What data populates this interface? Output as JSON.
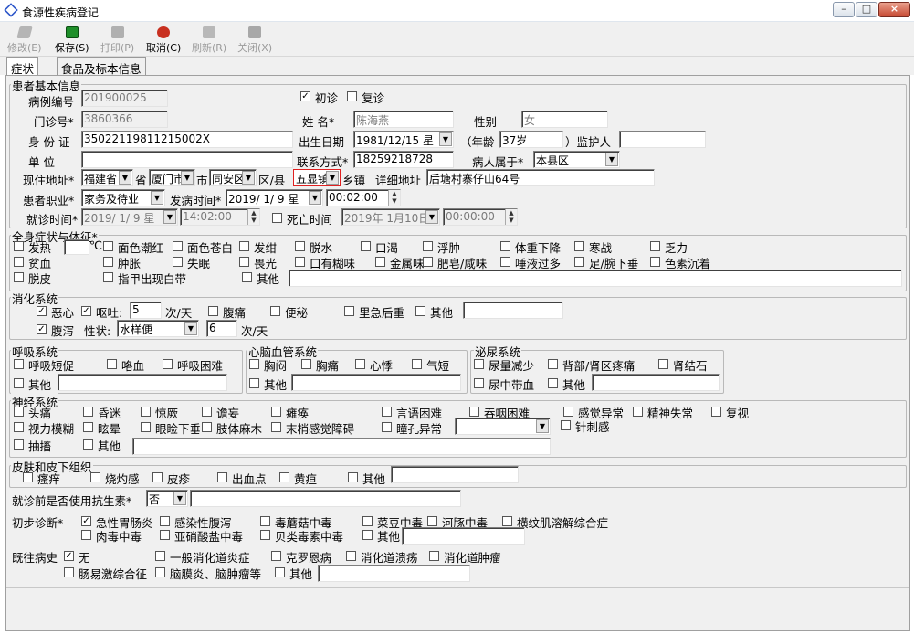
{
  "window": {
    "title": "食源性疾病登记"
  },
  "toolbar": {
    "items": [
      {
        "label": "修改(E)",
        "disabled": true
      },
      {
        "label": "保存(S)",
        "disabled": false
      },
      {
        "label": "打印(P)",
        "disabled": true
      },
      {
        "label": "取消(C)",
        "disabled": false
      },
      {
        "label": "刷新(R)",
        "disabled": true
      },
      {
        "label": "关闭(X)",
        "disabled": true
      }
    ]
  },
  "tabs": [
    "症状",
    "食品及标本信息"
  ],
  "patient": {
    "legend": "患者基本信息",
    "case_no_label": "病例编号",
    "case_no": "201900025",
    "first_visit": "初诊",
    "revisit": "复诊",
    "outpatient_label": "门诊号*",
    "outpatient_no": "3860366",
    "name_label": "姓 名*",
    "name": "陈海燕",
    "gender_label": "性别",
    "gender": "女",
    "id_label": "身 份 证",
    "id_no": "35022119811215002X",
    "birth_label": "出生日期",
    "birth": "1981/12/15 星",
    "age_open": "（年龄",
    "age": "37岁",
    "age_close": "）监护人",
    "guardian": "",
    "unit_label": "单 位",
    "unit": "",
    "contact_label": "联系方式*",
    "contact": "18259218728",
    "belong_label": "病人属于*",
    "belong": "本县区",
    "addr_label": "现住地址*",
    "province": "福建省",
    "province_suffix": "省",
    "city": "厦门市",
    "city_suffix": "市",
    "district": "同安区",
    "district_suffix": "区/县",
    "town": "五显镇",
    "town_suffix": "乡镇",
    "detail_label": "详细地址",
    "detail": "后塘村寨仔山64号",
    "job_label": "患者职业*",
    "job": "家务及待业",
    "onset_label": "发病时间*",
    "onset_date": "2019/ 1/ 9 星",
    "onset_time": "00:02:00",
    "visit_label": "就诊时间*",
    "visit_date": "2019/ 1/ 9 星",
    "visit_time": "14:02:00",
    "death_label": "死亡时间",
    "death_date": "2019年 1月10日",
    "death_time": "00:00:00"
  },
  "general": {
    "legend": "全身症状与体征*",
    "items": [
      "发热",
      "面色潮红",
      "面色苍白",
      "发绀",
      "脱水",
      "口渴",
      "浮肿",
      "体重下降",
      "寒战",
      "乏力",
      "贫血",
      "肿胀",
      "失眠",
      "畏光",
      "口有糊味",
      "金属味",
      "肥皂/咸味",
      "唾液过多",
      "足/腕下垂",
      "色素沉着",
      "脱皮",
      "指甲出现白带",
      "其他"
    ],
    "fever_unit": "℃"
  },
  "digestive": {
    "legend": "消化系统",
    "nausea": "恶心",
    "vomit": "呕吐:",
    "vomit_count": "5",
    "per_day": "次/天",
    "bellyache": "腹痛",
    "constipation": "便秘",
    "tenesmus": "里急后重",
    "other": "其他",
    "diarrhea": "腹泻",
    "nature_label": "性状:",
    "nature": "水样便",
    "diarrhea_count": "6",
    "per_day2": "次/天"
  },
  "respiratory": {
    "legend": "呼吸系统",
    "items": [
      "呼吸短促",
      "咯血",
      "呼吸困难",
      "其他"
    ]
  },
  "cardio": {
    "legend": "心脑血管系统",
    "items": [
      "胸闷",
      "胸痛",
      "心悸",
      "气短",
      "其他"
    ]
  },
  "urinary": {
    "legend": "泌尿系统",
    "items": [
      "尿量减少",
      "背部/肾区疼痛",
      "肾结石",
      "尿中带血",
      "其他"
    ]
  },
  "nervous": {
    "legend": "神经系统",
    "items": [
      "头痛",
      "昏迷",
      "惊厥",
      "谵妄",
      "瘫痪",
      "言语困难",
      "吞咽困难",
      "感觉异常",
      "精神失常",
      "复视",
      "视力模糊",
      "眩晕",
      "眼睑下垂",
      "肢体麻木",
      "末梢感觉障碍",
      "瞳孔异常",
      "针刺感",
      "抽搐",
      "其他"
    ]
  },
  "skin": {
    "legend": "皮肤和皮下组织",
    "items": [
      "瘙痒",
      "烧灼感",
      "皮疹",
      "出血点",
      "黄疸",
      "其他"
    ]
  },
  "antibiotic": {
    "label": "就诊前是否使用抗生素*",
    "value": "否"
  },
  "diagnosis": {
    "label": "初步诊断*",
    "items": [
      "急性胃肠炎",
      "感染性腹泻",
      "毒蘑菇中毒",
      "菜豆中毒",
      "河豚中毒",
      "横纹肌溶解综合症",
      "肉毒中毒",
      "亚硝酸盐中毒",
      "贝类毒素中毒",
      "其他"
    ]
  },
  "history": {
    "label": "既往病史",
    "items": [
      "无",
      "一般消化道炎症",
      "克罗恩病",
      "消化道溃疡",
      "消化道肿瘤",
      "肠易激综合征",
      "脑膜炎、脑肿瘤等",
      "其他"
    ]
  }
}
